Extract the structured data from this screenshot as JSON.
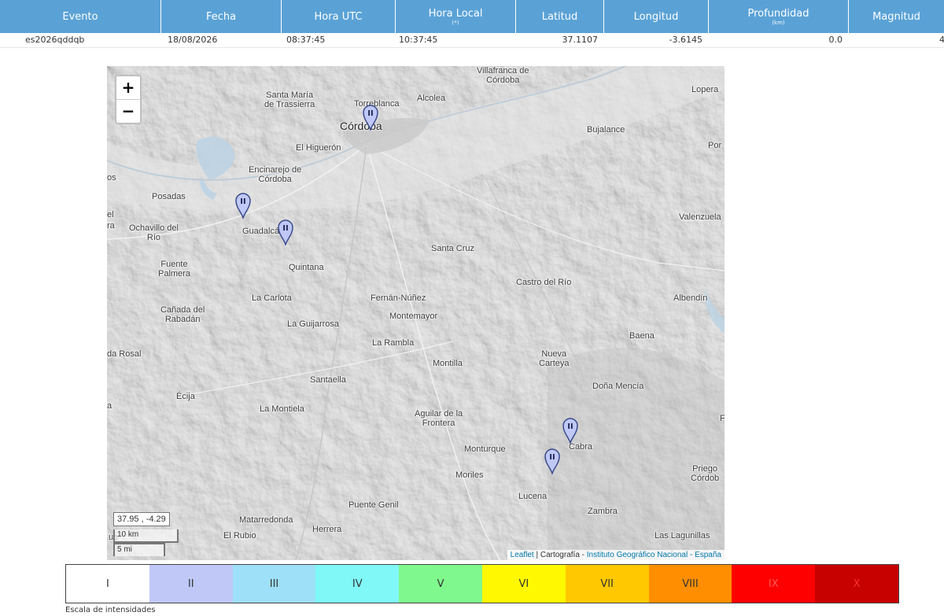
{
  "table": {
    "headers": [
      {
        "main": "Evento",
        "sub": ""
      },
      {
        "main": "Fecha",
        "sub": ""
      },
      {
        "main": "Hora UTC",
        "sub": ""
      },
      {
        "main": "Hora Local",
        "sub": "(*)"
      },
      {
        "main": "Latitud",
        "sub": ""
      },
      {
        "main": "Longitud",
        "sub": ""
      },
      {
        "main": "Profundidad",
        "sub": "(km)"
      },
      {
        "main": "Magnitud",
        "sub": ""
      }
    ],
    "row": {
      "evento": "es2026qddqb",
      "fecha": "18/08/2026",
      "hora_utc": "08:37:45",
      "hora_local": "10:37:45",
      "latitud": "37.1107",
      "longitud": "-3.6145",
      "profundidad": "0.0",
      "magnitud": "4"
    }
  },
  "map": {
    "zoom_in": "+",
    "zoom_out": "−",
    "coords": "37.95 , -4.29",
    "scale_km": "10 km",
    "scale_mi": "5 mi",
    "attribution": {
      "leaflet": "Leaflet",
      "sep": " | Cartografía - ",
      "source": "Instituto Geográfico Nacional - España"
    },
    "places": {
      "villafranca": "Villafranca de\nCórdoba",
      "lopera": "Lopera",
      "santa_maria": "Santa María\nde Trassierra",
      "torreblanca": "Torreblanca",
      "alcolea": "Alcolea",
      "cordoba": "Córdoba",
      "bujalance": "Bujalance",
      "por": "Por",
      "el_higueron": "El Higuerón",
      "encinarejo": "Encinarejo de\nCórdoba",
      "os": "os",
      "posadas": "Posadas",
      "el_left": "el",
      "ra_left": "ra",
      "ochavillo": "Ochavillo del\nRío",
      "guadalcazar": "Guadalcázar",
      "valenzuela": "Valenzuela",
      "santa_cruz": "Santa Cruz",
      "fuente_palmera": "Fuente\nPalmera",
      "quintana": "Quintana",
      "castro": "Castro del Río",
      "la_carlota": "La Carlota",
      "fernan_nunez": "Fernán-Núñez",
      "albendin": "Albendín",
      "canada": "Cañada del\nRabadán",
      "montemayor": "Montemayor",
      "la_guijarrosa": "La Guijarrosa",
      "baena": "Baena",
      "la_rambla": "La Rambla",
      "la_rosal": "da Rosal",
      "montilla": "Montilla",
      "nueva_carteya": "Nueva\nCarteya",
      "santaella": "Santaella",
      "dona_mencia": "Doña Mencía",
      "ecija": "Écija",
      "a_left": "a",
      "la_montiela": "La Montiela",
      "aguilar": "Aguilar de la\nFrontera",
      "f_right": "F",
      "monturque": "Monturque",
      "cabra": "Cabra",
      "moriles": "Moriles",
      "priego": "Priego\nCórdob",
      "lucena": "Lucena",
      "zambra": "Zambra",
      "puente_genil": "Puente Genil",
      "matarredonda": "Matarredonda",
      "herrera": "Herrera",
      "el_rubio": "El Rubio",
      "las_lagunillas": "Las Lagunillas",
      "ue": "ue"
    },
    "markers": [
      {
        "label": "II",
        "lon": -4.78,
        "lat": 37.885
      },
      {
        "label": "II",
        "lon": -4.99,
        "lat": 37.762
      },
      {
        "label": "II",
        "lon": -4.92,
        "lat": 37.725
      },
      {
        "label": "II",
        "lon": -4.45,
        "lat": 37.448
      },
      {
        "label": "II",
        "lon": -4.48,
        "lat": 37.405
      }
    ]
  },
  "intensity_scale": {
    "caption": "Escala de intensidades",
    "levels": [
      {
        "label": "I",
        "color": "#ffffff",
        "text": "#333333"
      },
      {
        "label": "II",
        "color": "#bfc8f7",
        "text": "#333333"
      },
      {
        "label": "III",
        "color": "#9ee0f7",
        "text": "#333333"
      },
      {
        "label": "IV",
        "color": "#7ff8f7",
        "text": "#333333"
      },
      {
        "label": "V",
        "color": "#7ff88d",
        "text": "#333333"
      },
      {
        "label": "VI",
        "color": "#fff800",
        "text": "#333333"
      },
      {
        "label": "VII",
        "color": "#ffc800",
        "text": "#333333"
      },
      {
        "label": "VIII",
        "color": "#ff8f00",
        "text": "#333333"
      },
      {
        "label": "IX",
        "color": "#ff0000",
        "text": "#ff5a5a"
      },
      {
        "label": "X",
        "color": "#c70000",
        "text": "#ff3030"
      }
    ]
  }
}
